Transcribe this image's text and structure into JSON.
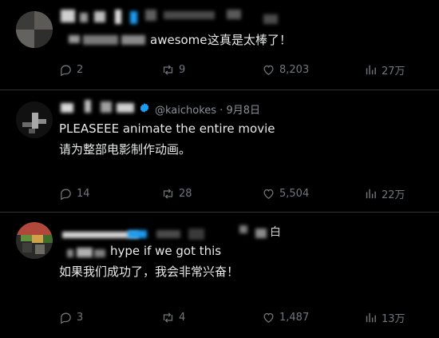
{
  "posts": [
    {
      "handle_date": "",
      "text_en": "awesome",
      "text_zh": "这真是太棒了！",
      "replies": "2",
      "reposts": "9",
      "likes": "8,203",
      "views": "27万"
    },
    {
      "handle_date": "@kaichokes · 9月8日",
      "text_en": "PLEASEEE animate the entire movie",
      "text_zh": "请为整部电影制作动画。",
      "replies": "14",
      "reposts": "28",
      "likes": "5,504",
      "views": "22万"
    },
    {
      "handle_date": "白",
      "text_en": "hype if we got this",
      "text_zh": "如果我们成功了，我会非常兴奋！",
      "replies": "3",
      "reposts": "4",
      "likes": "1,487",
      "views": "13万"
    }
  ],
  "colors": {
    "background": "#000000",
    "text": "#e7e9ea",
    "muted": "#71767b",
    "divider": "#2f3336",
    "verified": "#1d9bf0"
  },
  "icons": [
    "reply-icon",
    "repost-icon",
    "like-icon",
    "views-icon",
    "verified-badge-icon"
  ]
}
